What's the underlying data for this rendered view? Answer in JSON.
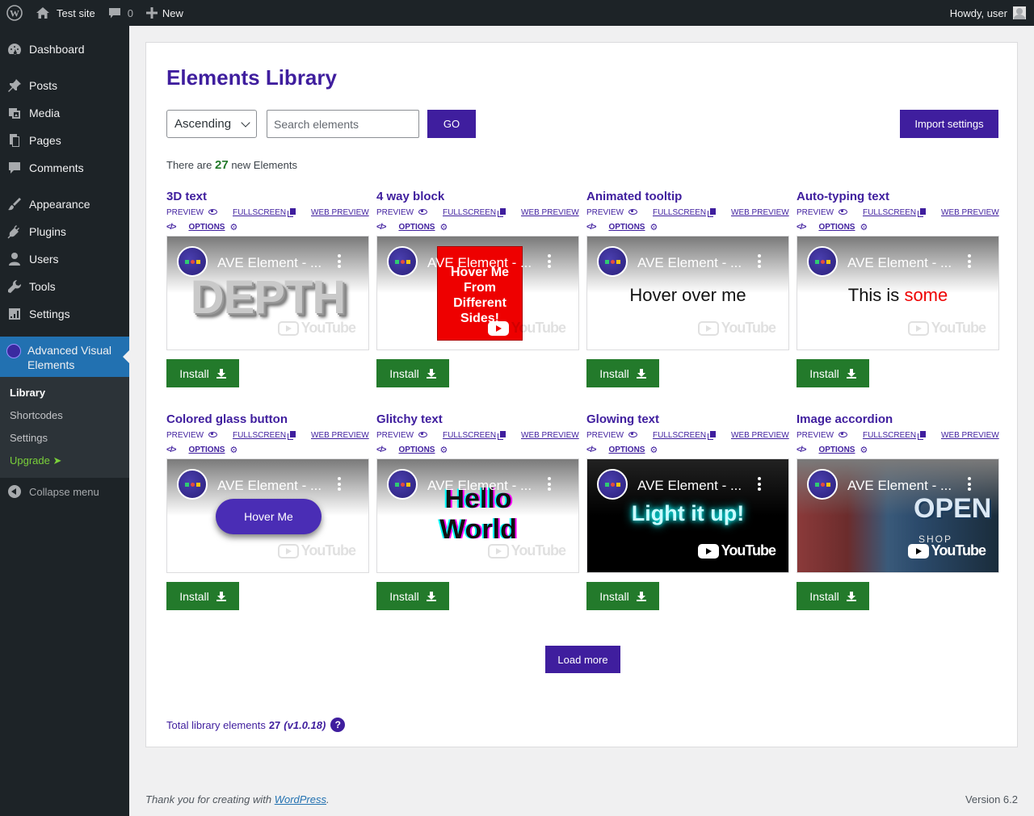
{
  "adminbar": {
    "site_name": "Test site",
    "comments_count": "0",
    "new_label": "New",
    "greeting": "Howdy, user"
  },
  "sidebar": {
    "items": [
      {
        "label": "Dashboard",
        "icon": "dashboard-icon"
      },
      {
        "label": "Posts",
        "icon": "pushpin-icon"
      },
      {
        "label": "Media",
        "icon": "media-icon"
      },
      {
        "label": "Pages",
        "icon": "pages-icon"
      },
      {
        "label": "Comments",
        "icon": "comments-icon"
      },
      {
        "label": "Appearance",
        "icon": "appearance-brush-icon"
      },
      {
        "label": "Plugins",
        "icon": "plugins-icon"
      },
      {
        "label": "Users",
        "icon": "users-icon"
      },
      {
        "label": "Tools",
        "icon": "wrench-icon"
      },
      {
        "label": "Settings",
        "icon": "settings-icon"
      },
      {
        "label": "Advanced Visual Elements",
        "icon": "ave-logo-icon"
      }
    ],
    "submenu": [
      "Library",
      "Shortcodes",
      "Settings",
      "Upgrade ➤"
    ],
    "collapse_label": "Collapse menu"
  },
  "main": {
    "title": "Elements Library",
    "sort_value": "Ascending",
    "search_placeholder": "Search elements",
    "go_label": "GO",
    "import_label": "Import settings",
    "new_prefix": "There are",
    "new_count": "27",
    "new_suffix": "new Elements",
    "link_preview": "PREVIEW",
    "link_fullscreen": "FULLSCREEN",
    "link_web_preview": "WEB PREVIEW",
    "link_options": "OPTIONS",
    "install_label": "Install",
    "video_title": "AVE Element - ...",
    "youtube_label": "YouTube",
    "elements": [
      {
        "name": "3D text",
        "demo": "DEPTH"
      },
      {
        "name": "4 way block",
        "demo": "Hover Me From Different Sides!"
      },
      {
        "name": "Animated tooltip",
        "demo": "Hover over me"
      },
      {
        "name": "Auto-typing text",
        "demo": "This is",
        "demo_highlight": "some"
      },
      {
        "name": "Colored glass button",
        "demo": "Hover Me"
      },
      {
        "name": "Glitchy text",
        "demo": "Hello World"
      },
      {
        "name": "Glowing text",
        "demo": "Light it up!"
      },
      {
        "name": "Image accordion",
        "demo": "OPEN",
        "demo_sub": "SHOP"
      }
    ],
    "load_more_label": "Load more",
    "total_label": "Total library elements",
    "total_count": "27",
    "version_tag": "(v1.0.18)",
    "help_label": "?"
  },
  "footer": {
    "thanks_prefix": "Thank you for creating with",
    "wordpress_link": "WordPress",
    "thanks_suffix": ".",
    "version": "Version 6.2"
  },
  "colors": {
    "brand_purple": "#3f1e9e",
    "install_green": "#237a2b",
    "admin_dark": "#1d2327",
    "admin_blue": "#2271b1"
  }
}
